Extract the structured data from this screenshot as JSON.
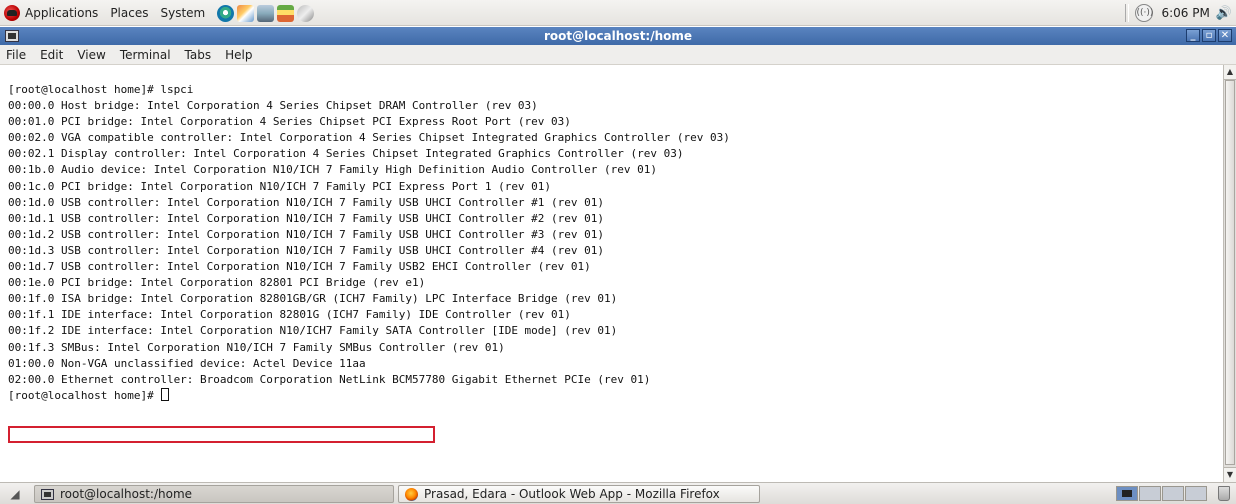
{
  "top_panel": {
    "menus": [
      "Applications",
      "Places",
      "System"
    ],
    "launchers": [
      "browser-icon",
      "mail-icon",
      "network-icon",
      "image-icon",
      "disk-icon"
    ],
    "clock": "6:06 PM",
    "icons": [
      "network-status-icon",
      "volume-icon"
    ]
  },
  "window": {
    "title": "root@localhost:/home",
    "controls": [
      "minimize",
      "maximize",
      "close"
    ]
  },
  "menubar": {
    "items": [
      "File",
      "Edit",
      "View",
      "Terminal",
      "Tabs",
      "Help"
    ]
  },
  "terminal": {
    "lines": [
      "[root@localhost home]# lspci",
      "00:00.0 Host bridge: Intel Corporation 4 Series Chipset DRAM Controller (rev 03)",
      "00:01.0 PCI bridge: Intel Corporation 4 Series Chipset PCI Express Root Port (rev 03)",
      "00:02.0 VGA compatible controller: Intel Corporation 4 Series Chipset Integrated Graphics Controller (rev 03)",
      "00:02.1 Display controller: Intel Corporation 4 Series Chipset Integrated Graphics Controller (rev 03)",
      "00:1b.0 Audio device: Intel Corporation N10/ICH 7 Family High Definition Audio Controller (rev 01)",
      "00:1c.0 PCI bridge: Intel Corporation N10/ICH 7 Family PCI Express Port 1 (rev 01)",
      "00:1d.0 USB controller: Intel Corporation N10/ICH 7 Family USB UHCI Controller #1 (rev 01)",
      "00:1d.1 USB controller: Intel Corporation N10/ICH 7 Family USB UHCI Controller #2 (rev 01)",
      "00:1d.2 USB controller: Intel Corporation N10/ICH 7 Family USB UHCI Controller #3 (rev 01)",
      "00:1d.3 USB controller: Intel Corporation N10/ICH 7 Family USB UHCI Controller #4 (rev 01)",
      "00:1d.7 USB controller: Intel Corporation N10/ICH 7 Family USB2 EHCI Controller (rev 01)",
      "00:1e.0 PCI bridge: Intel Corporation 82801 PCI Bridge (rev e1)",
      "00:1f.0 ISA bridge: Intel Corporation 82801GB/GR (ICH7 Family) LPC Interface Bridge (rev 01)",
      "00:1f.1 IDE interface: Intel Corporation 82801G (ICH7 Family) IDE Controller (rev 01)",
      "00:1f.2 IDE interface: Intel Corporation N10/ICH7 Family SATA Controller [IDE mode] (rev 01)",
      "00:1f.3 SMBus: Intel Corporation N10/ICH 7 Family SMBus Controller (rev 01)",
      "01:00.0 Non-VGA unclassified device: Actel Device 11aa",
      "02:00.0 Ethernet controller: Broadcom Corporation NetLink BCM57780 Gigabit Ethernet PCIe (rev 01)"
    ],
    "prompt": "[root@localhost home]# ",
    "highlighted_line_index": 17,
    "highlight_color": "#d42030"
  },
  "taskbar": {
    "tasks": [
      {
        "label": "root@localhost:/home",
        "active": true
      },
      {
        "label": "Prasad, Edara - Outlook Web App - Mozilla Firefox",
        "active": false
      }
    ]
  },
  "colors": {
    "titlebar": "#4a74b2",
    "terminal_bg": "#ffffff",
    "terminal_fg": "#111111"
  }
}
